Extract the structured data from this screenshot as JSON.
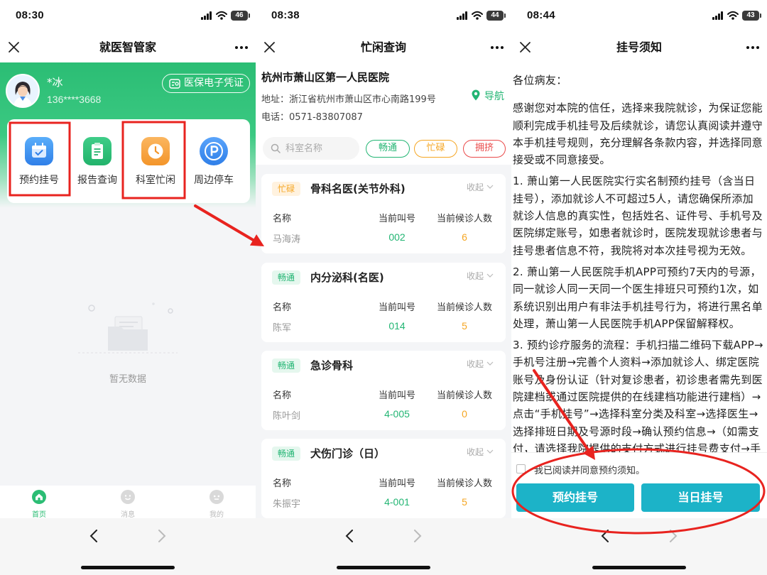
{
  "theme": {
    "brand_green": "#2bbd74",
    "smooth": "#22b573",
    "busy": "#f5a623",
    "crowded": "#ea4a4a",
    "action_teal": "#1cb3c8",
    "annotation_red": "#e8231f"
  },
  "screen1": {
    "status_bar": {
      "time": "08:30",
      "battery": "46"
    },
    "title": "就医智管家",
    "user": {
      "name": "*冰",
      "phone": "136****3668"
    },
    "insurance_button": "医保电子凭证",
    "services": [
      {
        "label": "预约挂号",
        "icon": "calendar-icon"
      },
      {
        "label": "报告查询",
        "icon": "report-icon"
      },
      {
        "label": "科室忙闲",
        "icon": "clock-icon"
      },
      {
        "label": "周边停车",
        "icon": "parking-icon"
      }
    ],
    "empty_text": "暂无数据",
    "tabs": [
      {
        "label": "首页",
        "icon": "home-icon",
        "active": true
      },
      {
        "label": "消息",
        "icon": "message-icon",
        "active": false
      },
      {
        "label": "我的",
        "icon": "profile-icon",
        "active": false
      }
    ]
  },
  "screen2": {
    "status_bar": {
      "time": "08:38",
      "battery": "44"
    },
    "title": "忙闲查询",
    "hospital": {
      "name": "杭州市萧山区第一人民医院",
      "address": "地址：浙江省杭州市萧山区市心南路199号",
      "phone": "电话：0571-83807087",
      "nav_label": "导航"
    },
    "search_placeholder": "科室名称",
    "filters": [
      "畅通",
      "忙碌",
      "拥挤"
    ],
    "columns": [
      "名称",
      "当前叫号",
      "当前候诊人数"
    ],
    "collapse_label": "收起",
    "departments": [
      {
        "status": "忙碌",
        "name": "骨科名医(关节外科)",
        "doctor": "马海涛",
        "number": "002",
        "waiting": "6"
      },
      {
        "status": "畅通",
        "name": "内分泌科(名医)",
        "doctor": "陈军",
        "number": "014",
        "waiting": "5"
      },
      {
        "status": "畅通",
        "name": "急诊骨科",
        "doctor": "陈叶剑",
        "number": "4-005",
        "waiting": "0"
      },
      {
        "status": "畅通",
        "name": "犬伤门诊（日）",
        "doctor": "朱振宇",
        "number": "4-001",
        "waiting": "5"
      }
    ]
  },
  "screen3": {
    "status_bar": {
      "time": "08:44",
      "battery": "43"
    },
    "title": "挂号须知",
    "greeting": "各位病友：",
    "paragraphs": [
      "感谢您对本院的信任，选择来我院就诊，为保证您能顺利完成手机挂号及后续就诊，请您认真阅读并遵守本手机挂号规则，充分理解各条款内容，并选择同意接受或不同意接受。",
      "1. 萧山第一人民医院实行实名制预约挂号（含当日挂号），添加就诊人不可超过5人，请您确保所添加就诊人信息的真实性，包括姓名、证件号、手机号及医院绑定账号，如患者就诊时，医院发现就诊患者与挂号患者信息不符，我院将对本次挂号视为无效。",
      "2. 萧山第一人民医院手机APP可预约7天内的号源，同一就诊人同一天同一个医生排班只可预约1次，如系统识别出用户有非法手机挂号行为，将进行黑名单处理，萧山第一人民医院手机APP保留解释权。",
      "3. 预约诊疗服务的流程：手机扫描二维码下载APP→手机号注册→完善个人资料→添加就诊人、绑定医院账号及身份认证（针对复诊患者，初诊患者需先到医院建档或通过医院提供的在线建档功能进行建档）→点击“手机挂号”→选择科室分类及科室→选择医生→选择排班日期及号源时段→确认预约信息→（如需支付，请选择我院提供的支付方式进行挂号费支付→手"
    ],
    "agree_label": "我已阅读并同意预约须知。",
    "buttons": [
      "预约挂号",
      "当日挂号"
    ]
  }
}
